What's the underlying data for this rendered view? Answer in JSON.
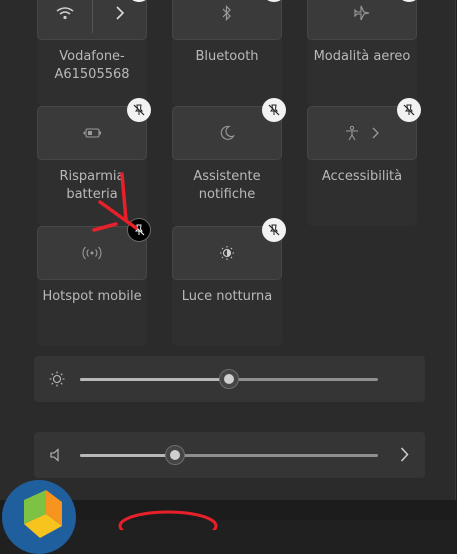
{
  "tiles": [
    {
      "id": "wifi",
      "label": "Vodafone-\nA61505568",
      "icon": "wifi-icon"
    },
    {
      "id": "bluetooth",
      "label": "Bluetooth",
      "icon": "bluetooth-icon"
    },
    {
      "id": "airplane",
      "label": "Modalità aereo",
      "icon": "airplane-icon"
    },
    {
      "id": "battery_saver",
      "label": "Risparmia\nbatteria",
      "icon": "battery-saver-icon"
    },
    {
      "id": "focus",
      "label": "Assistente\nnotifiche",
      "icon": "moon-icon"
    },
    {
      "id": "accessibility",
      "label": "Accessibilità",
      "icon": "accessibility-icon"
    },
    {
      "id": "hotspot",
      "label": "Hotspot mobile",
      "icon": "hotspot-icon"
    },
    {
      "id": "night_light",
      "label": "Luce notturna",
      "icon": "night-light-icon"
    }
  ],
  "sliders": {
    "brightness": {
      "value_percent": 50,
      "icon": "brightness-icon"
    },
    "volume": {
      "value_percent": 32,
      "icon": "speaker-icon"
    }
  },
  "colors": {
    "panel_bg": "#2b2b2b",
    "tile_bg": "#3a3a3a",
    "annotation_red": "#e8202a",
    "unpin_badge": "#f2f2f2"
  }
}
